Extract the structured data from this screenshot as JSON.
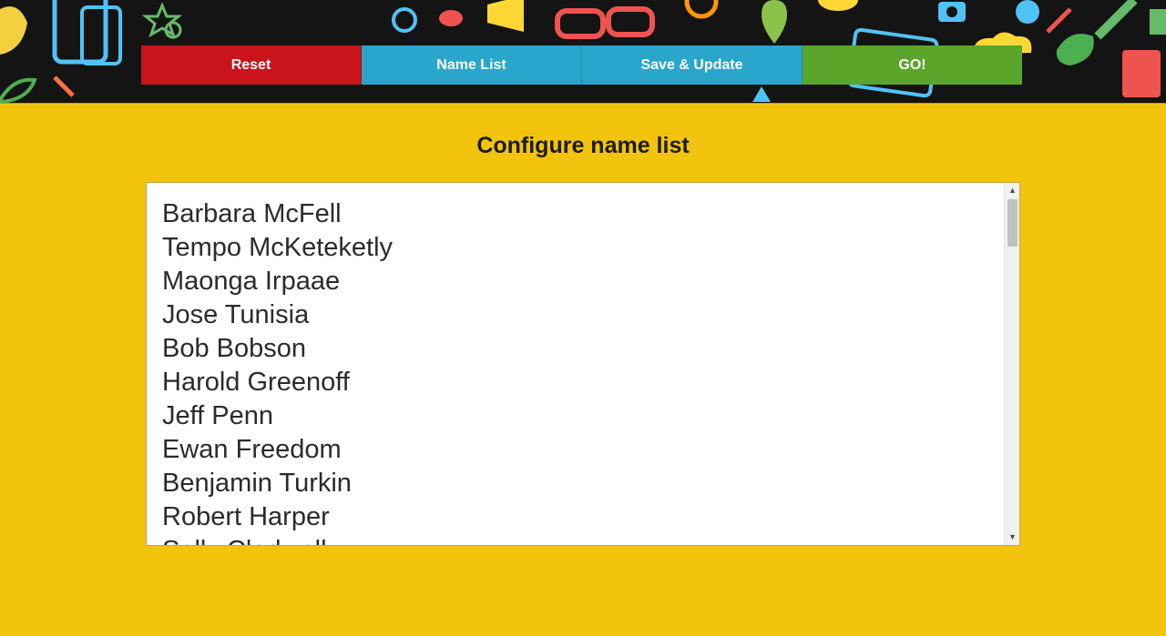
{
  "toolbar": {
    "buttons": [
      {
        "label": "Reset",
        "color": "#c8141a"
      },
      {
        "label": "Name List",
        "color": "#2aa6cd"
      },
      {
        "label": "Save & Update",
        "color": "#2aa6cd"
      },
      {
        "label": "GO!",
        "color": "#5aa52a"
      }
    ]
  },
  "page": {
    "title": "Configure name list"
  },
  "namelist": {
    "names": [
      "Barbara McFell",
      "Tempo McKeteketly",
      "Maonga Irpaae",
      "Jose Tunisia",
      "Bob Bobson",
      "Harold Greenoff",
      "Jeff Penn",
      "Ewan Freedom",
      "Benjamin Turkin",
      "Robert Harper",
      "Sally Clodwell"
    ]
  },
  "colors": {
    "background": "#f2c40d",
    "header": "#141414"
  }
}
